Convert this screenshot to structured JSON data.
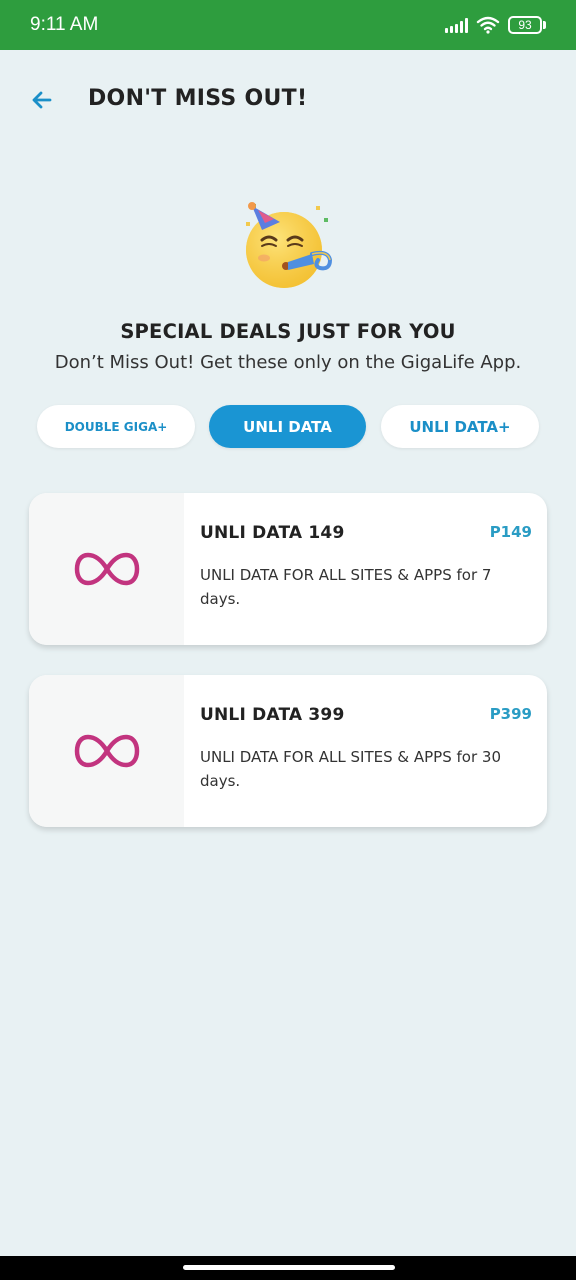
{
  "status_bar": {
    "time": "9:11 AM",
    "battery": "93",
    "icons": [
      "signal-icon",
      "wifi-icon",
      "battery-icon"
    ]
  },
  "header": {
    "title": "DON'T MISS OUT!",
    "back_icon": "back-arrow-icon"
  },
  "hero": {
    "emoji": "party-face-icon",
    "title": "SPECIAL DEALS JUST FOR YOU",
    "subtitle": "Don’t Miss Out! Get these only on the GigaLife App."
  },
  "tabs": [
    {
      "label": "DOUBLE GIGA+",
      "active": false
    },
    {
      "label": "UNLI DATA",
      "active": true
    },
    {
      "label": "UNLI DATA+",
      "active": false
    }
  ],
  "deals": [
    {
      "name": "UNLI DATA 149",
      "price": "P149",
      "description": "UNLI DATA FOR ALL SITES & APPS for 7 days.",
      "icon": "infinity-icon"
    },
    {
      "name": "UNLI DATA 399",
      "price": "P399",
      "description": "UNLI DATA FOR ALL SITES & APPS for 30 days.",
      "icon": "infinity-icon"
    }
  ],
  "colors": {
    "status_bar": "#2e9d3e",
    "background": "#e8f1f3",
    "accent": "#1a95d3",
    "price": "#2a9cc4",
    "infinity": "#c2347f"
  }
}
